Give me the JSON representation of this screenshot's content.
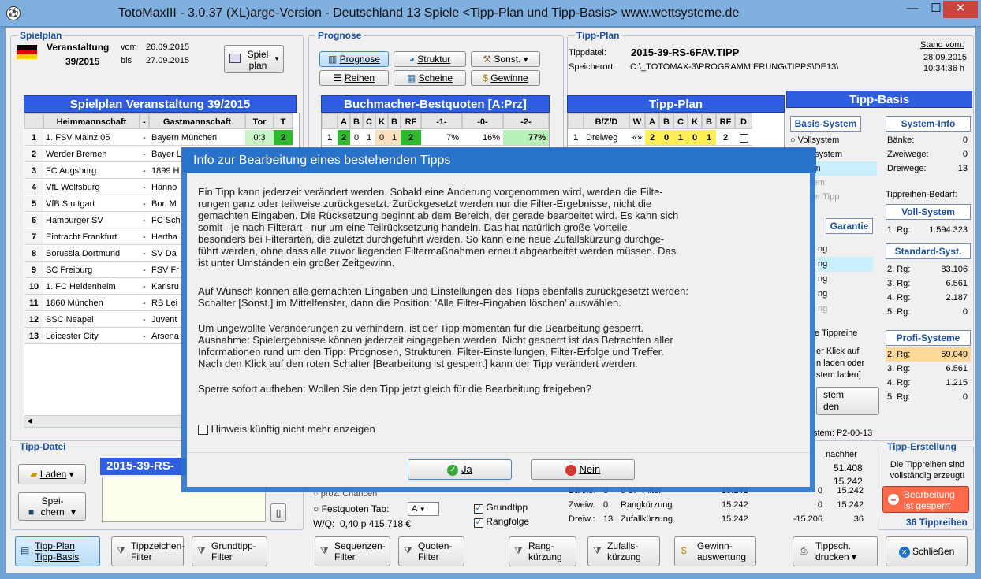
{
  "title": "TotoMaxIII - 3.0.37 (XL)arge-Version - Deutschland 13 Spiele     <Tipp-Plan und Tipp-Basis>     www.wettsysteme.de",
  "spielplan": {
    "group": "Spielplan",
    "veranstaltung": "Veranstaltung",
    "vom_label": "vom",
    "vom": "26.09.2015",
    "bis_label": "bis",
    "bis": "27.09.2015",
    "nr": "39/2015",
    "btn": "Spiel plan",
    "header": "Spielplan Veranstaltung 39/2015",
    "cols": [
      "Heimmannschaft",
      "-",
      "Gastmannschaft",
      "Tor",
      "T"
    ],
    "rows": [
      {
        "n": "1",
        "home": "1. FSV Mainz 05",
        "away": "Bayern München",
        "tor": "0:3",
        "t": "2"
      },
      {
        "n": "2",
        "home": "Werder Bremen",
        "away": "Bayer L",
        "tor": "",
        "t": ""
      },
      {
        "n": "3",
        "home": "FC Augsburg",
        "away": "1899 H",
        "tor": "",
        "t": ""
      },
      {
        "n": "4",
        "home": "VfL Wolfsburg",
        "away": "Hanno",
        "tor": "",
        "t": ""
      },
      {
        "n": "5",
        "home": "VfB Stuttgart",
        "away": "Bor. M",
        "tor": "",
        "t": ""
      },
      {
        "n": "6",
        "home": "Hamburger SV",
        "away": "FC Sch",
        "tor": "",
        "t": ""
      },
      {
        "n": "7",
        "home": "Eintracht Frankfurt",
        "away": "Hertha",
        "tor": "",
        "t": ""
      },
      {
        "n": "8",
        "home": "Borussia Dortmund",
        "away": "SV Da",
        "tor": "",
        "t": ""
      },
      {
        "n": "9",
        "home": "SC Freiburg",
        "away": "FSV Fr",
        "tor": "",
        "t": ""
      },
      {
        "n": "10",
        "home": "1. FC Heidenheim",
        "away": "Karlsru",
        "tor": "",
        "t": ""
      },
      {
        "n": "11",
        "home": "1860 München",
        "away": "RB Lei",
        "tor": "",
        "t": ""
      },
      {
        "n": "12",
        "home": "SSC Neapel",
        "away": "Juvent",
        "tor": "",
        "t": ""
      },
      {
        "n": "13",
        "home": "Leicester City",
        "away": "Arsena",
        "tor": "",
        "t": ""
      }
    ]
  },
  "prognose": {
    "group": "Prognose",
    "btn_prognose": "Prognose",
    "btn_struktur": "Struktur",
    "btn_sonst": "Sonst.",
    "btn_reihen": "Reihen",
    "btn_scheine": "Scheine",
    "btn_gewinne": "Gewinne",
    "header": "Buchmacher-Bestquoten  [A:Prz]",
    "cols": [
      "A",
      "B",
      "C",
      "K",
      "B",
      "RF",
      "-1-",
      "-0-",
      "-2-"
    ],
    "row1": {
      "n": "1",
      "a": "2",
      "b": "0",
      "c": "1",
      "k": "0",
      "b2": "1",
      "rf": "2",
      "p1": "7%",
      "p0": "16%",
      "p2": "77%"
    },
    "proz": "proz. Chancen",
    "festquoten": "Festquoten Tab:",
    "festquoten_val": "A",
    "grundtipp": "Grundtipp",
    "rangfolge": "Rangfolge",
    "wq_label": "W/Q:",
    "wq": "0,40 p  415.718 €"
  },
  "tippplan": {
    "group": "Tipp-Plan",
    "tippdatei_label": "Tippdatei:",
    "tippdatei": "2015-39-RS-6FAV.TIPP",
    "speicherort_label": "Speicherort:",
    "speicherort": "C:\\_TOTOMAX-3\\PROGRAMMIERUNG\\TIPPS\\DE13\\",
    "stand_label": "Stand vom:",
    "stand_date": "28.09.2015",
    "stand_time": "10:34:36 h",
    "header": "Tipp-Plan",
    "cols": [
      "B/Z/D",
      "W",
      "A",
      "B",
      "C",
      "K",
      "B",
      "RF",
      "D"
    ],
    "row1": {
      "n": "1",
      "bzd": "Dreiweg",
      "w": "«»",
      "a": "2",
      "b": "0",
      "c": "1",
      "k": "0",
      "b2": "1",
      "rf": "2"
    },
    "stats": [
      {
        "label": "Bänke:",
        "v1": "0",
        "label2": "0  SP-Filter",
        "v2": "15.242",
        "v3": "0",
        "v4": "15.242"
      },
      {
        "label": "Zweiw.",
        "v1": "0",
        "label2": "Rangkürzung",
        "v2": "15.242",
        "v3": "0",
        "v4": "15.242"
      },
      {
        "label": "Dreiw.:",
        "v1": "13",
        "label2": "Zufallkürzung",
        "v2": "15.242",
        "v3": "-15.206",
        "v4": "36"
      }
    ],
    "nachher_label": "nachher",
    "nachher": [
      "51.408",
      "15.242"
    ]
  },
  "tippbasis": {
    "header": "Tipp-Basis",
    "basis_title": "Basis-System",
    "basis_opts": [
      "Vollsystem",
      "dardsystem",
      "ystem",
      "system",
      "rterter Tipp"
    ],
    "garantie": "Garantie",
    "garantie_items": [
      "ng",
      "ng",
      "ng",
      "ng",
      "ng"
    ],
    "tippreihe": "e Tippreihe",
    "klick_text": [
      "er Klick auf",
      "n laden oder",
      "stem laden]"
    ],
    "system_btn": [
      "stem",
      "den"
    ],
    "system_label": "stem: P2-00-13",
    "info_title": "System-Info",
    "info": [
      {
        "k": "Bänke:",
        "v": "0"
      },
      {
        "k": "Zweiwege:",
        "v": "0"
      },
      {
        "k": "Dreiwege:",
        "v": "13"
      }
    ],
    "bedarf": "Tippreihen-Bedarf:",
    "voll_title": "Voll-System",
    "voll": [
      {
        "k": "1. Rg:",
        "v": "1.594.323"
      }
    ],
    "std_title": "Standard-Syst.",
    "std": [
      {
        "k": "2. Rg:",
        "v": "83.106"
      },
      {
        "k": "3. Rg:",
        "v": "6.561"
      },
      {
        "k": "4. Rg:",
        "v": "2.187"
      },
      {
        "k": "5. Rg:",
        "v": "0"
      }
    ],
    "profi_title": "Profi-Systeme",
    "profi": [
      {
        "k": "2. Rg:",
        "v": "59.049"
      },
      {
        "k": "3. Rg:",
        "v": "6.561"
      },
      {
        "k": "4. Rg:",
        "v": "1.215"
      },
      {
        "k": "5. Rg:",
        "v": "0"
      }
    ]
  },
  "tippdatei": {
    "group": "Tipp-Datei",
    "name": "2015-39-RS-",
    "laden": "Laden",
    "speichern": "Spei-chern"
  },
  "erstellung": {
    "group": "Tipp-Erstellung",
    "text": "Die Tippreihen sind vollständig erzeugt!",
    "btn": "Bearbeitung ist gesperrt",
    "reihen": "36 Tippreihen"
  },
  "bottom": {
    "b1": "Tipp-Plan Tipp-Basis",
    "b2": "Tippzeichen- Filter",
    "b3": "Grundtipp- Filter",
    "b4": "Sequenzen- Filter",
    "b5": "Quoten- Filter",
    "b6": "Rang- kürzung",
    "b7": "Zufalls- kürzung",
    "b8": "Gewinn- auswertung",
    "b9": "Tippsch. drucken",
    "b10": "Schließen"
  },
  "dialog": {
    "title": "Info zur Bearbeitung eines bestehenden Tipps",
    "p1": [
      "Ein Tipp kann jederzeit verändert werden. Sobald eine Änderung vorgenommen wird, werden die Filte-",
      "rungen ganz oder teilweise zurückgesetzt. Zurückgesetzt werden nur die Filter-Ergebnisse, nicht die",
      "gemachten Eingaben. Die Rücksetzung beginnt ab dem Bereich, der gerade bearbeitet wird. Es kann sich",
      "somit - je nach Filterart - nur um eine Teilrücksetzung handeln. Das hat natürlich große Vorteile,",
      "besonders bei Filterarten, die zuletzt durchgeführt werden. So kann eine neue Zufallskürzung durchge-",
      "führt werden, ohne dass alle zuvor liegenden Filtermaßnahmen erneut abgearbeitet werden müssen. Das",
      "ist unter Umständen ein großer Zeitgewinn."
    ],
    "p2": [
      "Auf Wunsch können alle gemachten Eingaben und Einstellungen des Tipps ebenfalls zurückgesetzt werden:",
      "Schalter [Sonst.] im Mittelfenster, dann die Position: 'Alle Filter-Eingaben löschen' auswählen."
    ],
    "p3": [
      "Um ungewollte Veränderungen zu verhindern, ist der Tipp momentan für die Bearbeitung gesperrt.",
      "Ausnahme: Spielergebnisse können jederzeit eingegeben werden. Nicht gesperrt ist das Betrachten aller",
      "Informationen rund um den Tipp: Prognosen, Strukturen, Filter-Einstellungen, Filter-Erfolge und Treffer.",
      "Nach den Klick auf den roten Schalter [Bearbeitung ist gesperrt] kann der Tipp verändert werden."
    ],
    "p4": "Sperre sofort aufheben: Wollen Sie den Tipp jetzt gleich für die Bearbeitung freigeben?",
    "checkbox": "Hinweis künftig nicht mehr anzeigen",
    "ja": "Ja",
    "nein": "Nein"
  }
}
